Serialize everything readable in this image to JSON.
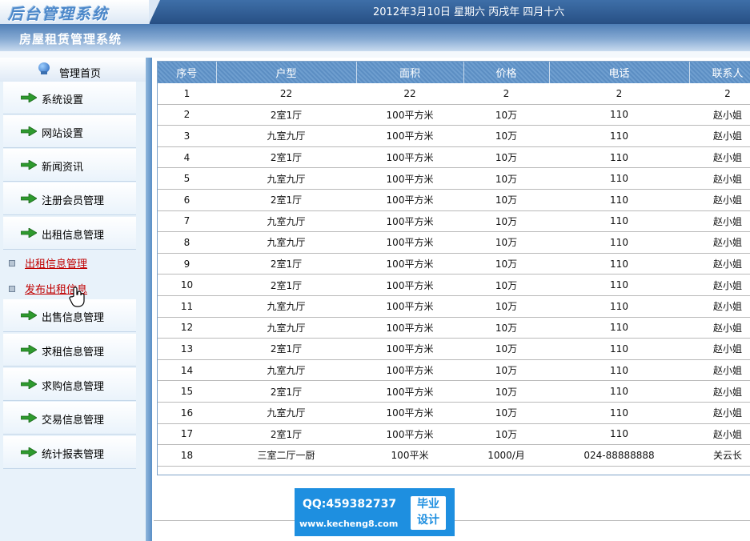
{
  "header": {
    "logo": "后台管理系统",
    "date": "2012年3月10日  星期六  丙戌年  四月十六",
    "system_title": "房屋租赁管理系统"
  },
  "sidebar": {
    "home": "管理首页",
    "items": [
      {
        "label": "系统设置"
      },
      {
        "label": "网站设置"
      },
      {
        "label": "新闻资讯"
      },
      {
        "label": "注册会员管理"
      },
      {
        "label": "出租信息管理"
      },
      {
        "label": "出售信息管理"
      },
      {
        "label": "求租信息管理"
      },
      {
        "label": "求购信息管理"
      },
      {
        "label": "交易信息管理"
      },
      {
        "label": "统计报表管理"
      }
    ],
    "subitems": [
      {
        "label": "出租信息管理"
      },
      {
        "label": "发布出租信息"
      }
    ]
  },
  "table": {
    "columns": [
      "序号",
      "户型",
      "面积",
      "价格",
      "电话",
      "联系人"
    ],
    "rows": [
      [
        "1",
        "22",
        "22",
        "2",
        "2",
        "2"
      ],
      [
        "2",
        "2室1厅",
        "100平方米",
        "10万",
        "110",
        "赵小姐"
      ],
      [
        "3",
        "九室九厅",
        "100平方米",
        "10万",
        "110",
        "赵小姐"
      ],
      [
        "4",
        "2室1厅",
        "100平方米",
        "10万",
        "110",
        "赵小姐"
      ],
      [
        "5",
        "九室九厅",
        "100平方米",
        "10万",
        "110",
        "赵小姐"
      ],
      [
        "6",
        "2室1厅",
        "100平方米",
        "10万",
        "110",
        "赵小姐"
      ],
      [
        "7",
        "九室九厅",
        "100平方米",
        "10万",
        "110",
        "赵小姐"
      ],
      [
        "8",
        "九室九厅",
        "100平方米",
        "10万",
        "110",
        "赵小姐"
      ],
      [
        "9",
        "2室1厅",
        "100平方米",
        "10万",
        "110",
        "赵小姐"
      ],
      [
        "10",
        "2室1厅",
        "100平方米",
        "10万",
        "110",
        "赵小姐"
      ],
      [
        "11",
        "九室九厅",
        "100平方米",
        "10万",
        "110",
        "赵小姐"
      ],
      [
        "12",
        "九室九厅",
        "100平方米",
        "10万",
        "110",
        "赵小姐"
      ],
      [
        "13",
        "2室1厅",
        "100平方米",
        "10万",
        "110",
        "赵小姐"
      ],
      [
        "14",
        "九室九厅",
        "100平方米",
        "10万",
        "110",
        "赵小姐"
      ],
      [
        "15",
        "2室1厅",
        "100平方米",
        "10万",
        "110",
        "赵小姐"
      ],
      [
        "16",
        "九室九厅",
        "100平方米",
        "10万",
        "110",
        "赵小姐"
      ],
      [
        "17",
        "2室1厅",
        "100平方米",
        "10万",
        "110",
        "赵小姐"
      ],
      [
        "18",
        "三室二厅一厨",
        "100平米",
        "1000/月",
        "024-88888888",
        "关云长"
      ]
    ]
  },
  "watermark": {
    "qq": "QQ:459382737",
    "url": "www.kecheng8.com",
    "tag_line1": "毕业",
    "tag_line2": "设计"
  },
  "colors": {
    "header_blue": "#274f84",
    "table_header_blue": "#5c8ec3",
    "link_red": "#c00000",
    "watermark_blue": "#1e8fe0"
  }
}
